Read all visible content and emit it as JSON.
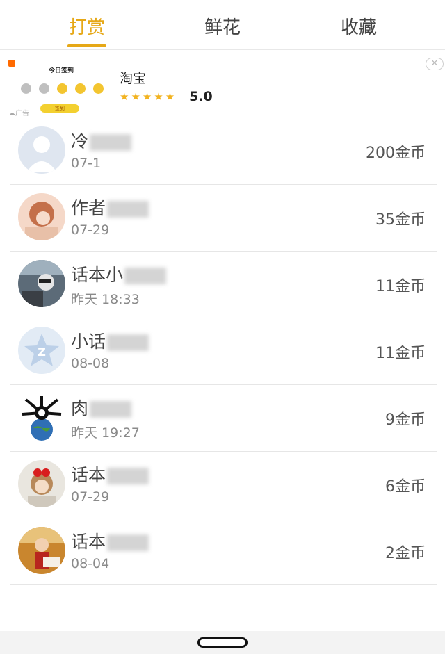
{
  "tabs": {
    "tab1": "打赏",
    "tab2": "鲜花",
    "tab3": "收藏",
    "active": "打赏"
  },
  "ad": {
    "app_name": "淘宝",
    "rating": "5.0",
    "stars": "★★★★★",
    "label": "☁广告",
    "thumb_title": "今日签到",
    "thumb_button": "签到",
    "close_glyph": "✕"
  },
  "records": [
    {
      "name": "冷",
      "time": "07-1",
      "amount": "200金币"
    },
    {
      "name": "作者",
      "time": "07-29",
      "amount": "35金币"
    },
    {
      "name": "话本小",
      "time": "昨天 18:33",
      "amount": "11金币"
    },
    {
      "name": "小话",
      "time": "08-08",
      "amount": "11金币"
    },
    {
      "name": "肉",
      "time": "昨天 19:27",
      "amount": "9金币"
    },
    {
      "name": "话本",
      "time": "07-29",
      "amount": "6金币"
    },
    {
      "name": "话本",
      "time": "08-04",
      "amount": "2金币"
    }
  ],
  "colors": {
    "accent": "#e6a817",
    "text_primary": "#444444",
    "text_secondary": "#8a8a8a"
  }
}
